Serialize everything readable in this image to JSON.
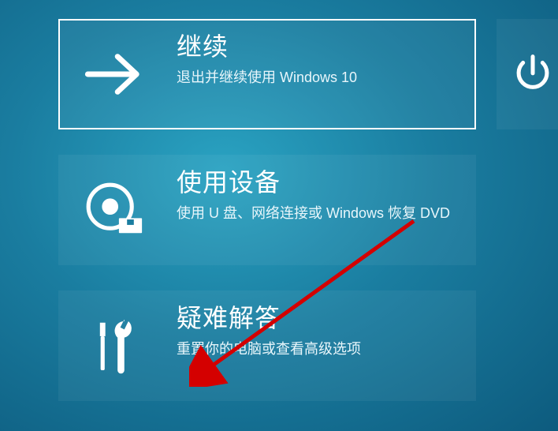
{
  "options": {
    "continue": {
      "title": "继续",
      "subtitle": "退出并继续使用 Windows 10"
    },
    "use_device": {
      "title": "使用设备",
      "subtitle": "使用 U 盘、网络连接或 Windows 恢复 DVD"
    },
    "troubleshoot": {
      "title": "疑难解答",
      "subtitle": "重置你的电脑或查看高级选项"
    }
  },
  "icons": {
    "continue": "arrow-right-icon",
    "use_device": "disc-drive-icon",
    "troubleshoot": "tools-icon",
    "power": "power-icon"
  }
}
